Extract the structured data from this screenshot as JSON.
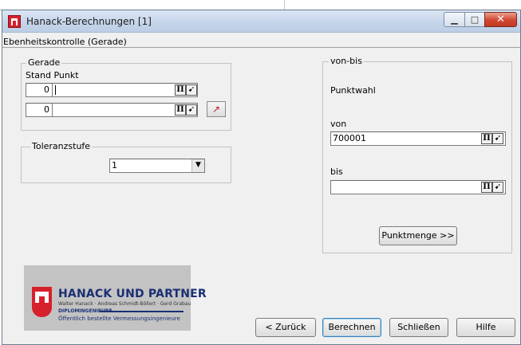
{
  "window": {
    "title": "Hanack-Berechnungen [1]",
    "subtitle": "Ebenheitskontrolle (Gerade)"
  },
  "gerade": {
    "legend": "Gerade",
    "header": "Stand Punkt",
    "row1_number": "0",
    "row1_value": "",
    "row2_number": "0",
    "row2_value": ""
  },
  "toleranz": {
    "legend": "Toleranzstufe",
    "selected": "1"
  },
  "vonbis": {
    "legend": "von-bis",
    "punktwahl": "Punktwahl",
    "von_label": "von",
    "von_value": "700001",
    "bis_label": "bis",
    "bis_value": "",
    "punktmenge_label": "Punktmenge >>"
  },
  "logo": {
    "name": "HANACK UND PARTNER",
    "partners": "Walter Hanack · Andreas Schmidt-Böllert · Gerd Grabau",
    "diplom": "DIPLOMINGENIEURE",
    "tagline": "Öffentlich bestellte Vermessungsingenieure"
  },
  "footer": {
    "back_label": "< Zurück",
    "calc_label": "Berechnen",
    "close_label": "Schließen",
    "help_label": "Hilfe"
  },
  "icons": {
    "app": "hamburg-crest-icon",
    "minimize": "minimize-icon",
    "maximize": "maximize-icon",
    "close": "close-icon",
    "point_pick": "point-pick-icon",
    "point_select": "point-select-icon",
    "line_tool": "line-tool-icon",
    "dropdown": "chevron-down-icon"
  },
  "colors": {
    "close_button": "#c23a24",
    "logo_text": "#1a2f73",
    "crest_red": "#d6202b"
  }
}
